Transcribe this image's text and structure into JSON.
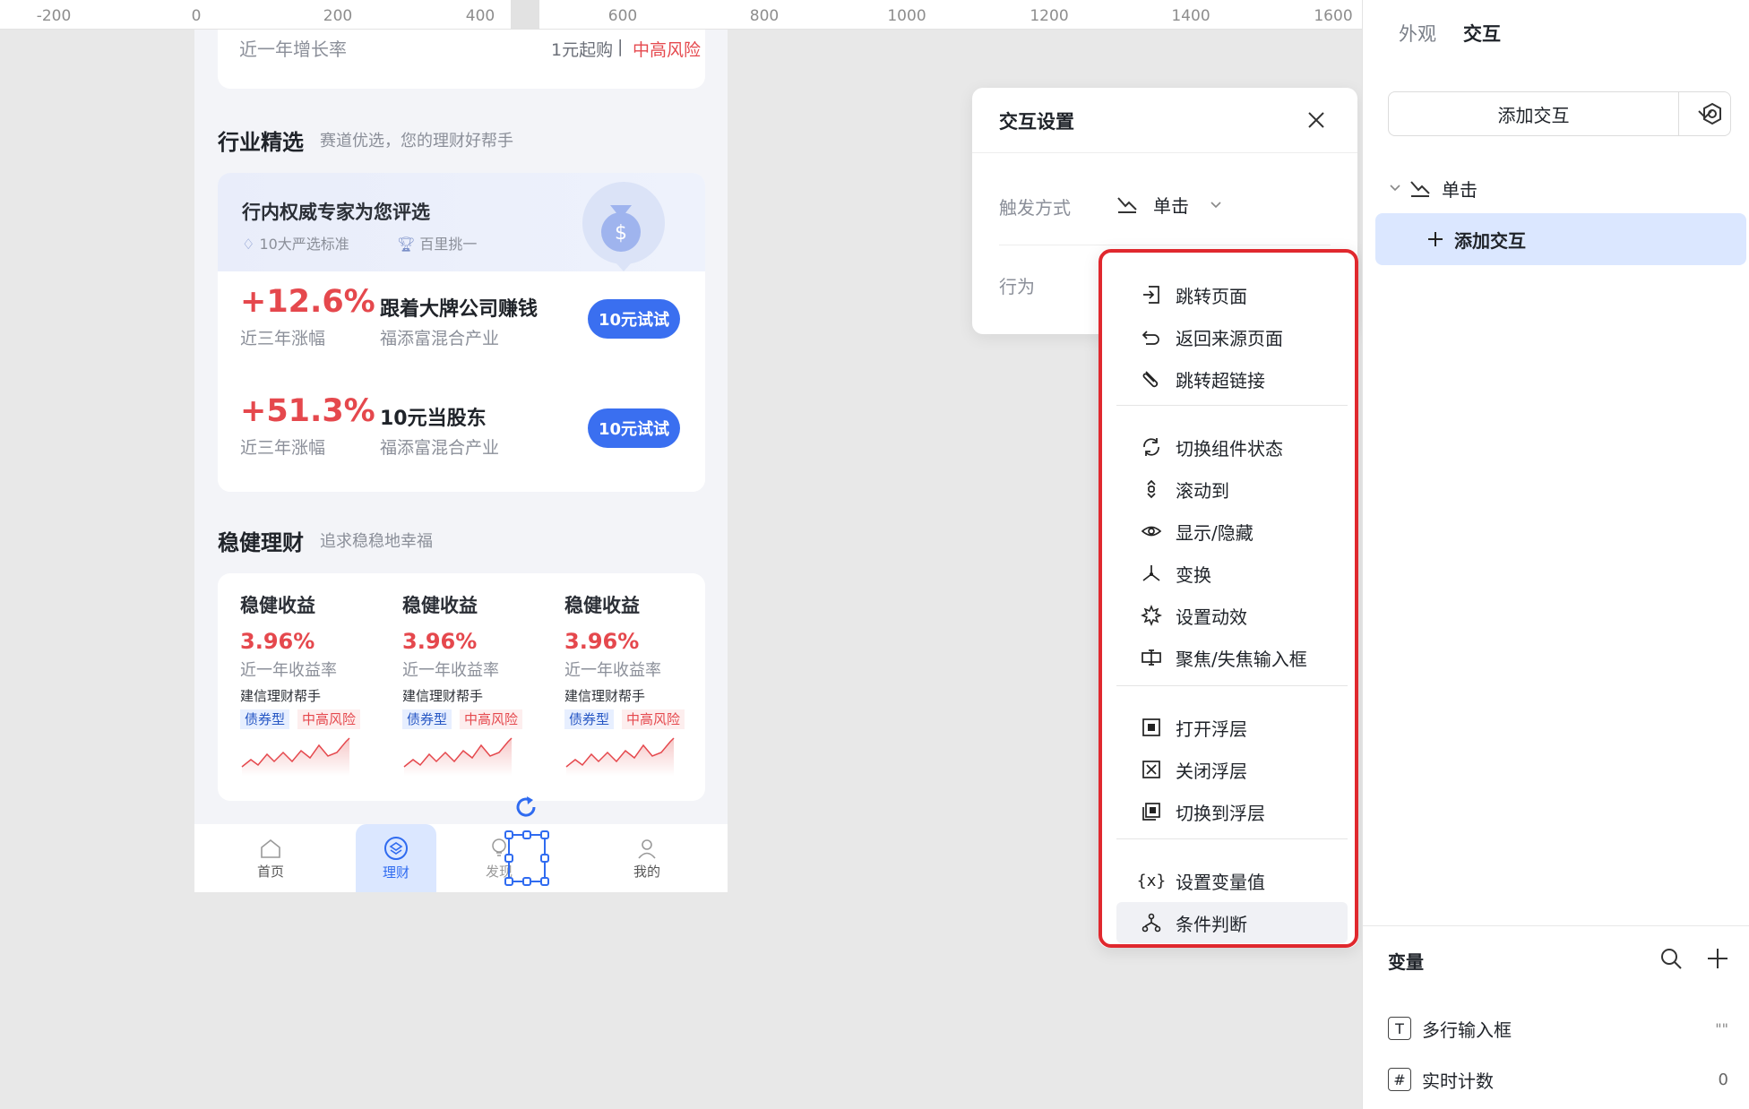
{
  "ruler": {
    "ticks": [
      "-200",
      "0",
      "200",
      "400",
      "600",
      "800",
      "1000",
      "1200",
      "1400",
      "1600"
    ]
  },
  "phone": {
    "top_card": {
      "label": "近一年增长率",
      "start": "1元起购",
      "divider": "|",
      "risk": "中高风险"
    },
    "industry": {
      "title": "行业精选",
      "subtitle": "赛道优选，您的理财好帮手",
      "banner_title": "行内权威专家为您评选",
      "badge1": "10大严选标准",
      "badge2": "百里挑一",
      "funds": [
        {
          "rate": "+12.6%",
          "rate_label": "近三年涨幅",
          "name": "跟着大牌公司赚钱",
          "sub": "福添富混合产业",
          "btn": "10元试试"
        },
        {
          "rate": "+51.3%",
          "rate_label": "近三年涨幅",
          "name": "10元当股东",
          "sub": "福添富混合产业",
          "btn": "10元试试"
        }
      ]
    },
    "stable": {
      "title": "稳健理财",
      "subtitle": "追求稳稳地幸福",
      "items": [
        {
          "name": "稳健收益",
          "rate": "3.96%",
          "rate_label": "近一年收益率",
          "manager": "建信理财帮手",
          "tag1": "债券型",
          "tag2": "中高风险"
        },
        {
          "name": "稳健收益",
          "rate": "3.96%",
          "rate_label": "近一年收益率",
          "manager": "建信理财帮手",
          "tag1": "债券型",
          "tag2": "中高风险"
        },
        {
          "name": "稳健收益",
          "rate": "3.96%",
          "rate_label": "近一年收益率",
          "manager": "建信理财帮手",
          "tag1": "债券型",
          "tag2": "中高风险"
        }
      ]
    },
    "tabbar": {
      "home": "首页",
      "finance": "理财",
      "discover": "发现",
      "mine": "我的"
    }
  },
  "popup": {
    "title": "交互设置",
    "trigger_label": "触发方式",
    "trigger_value": "单击",
    "action_label": "行为"
  },
  "dropdown": {
    "groups": [
      [
        {
          "label": "跳转页面",
          "icon": "page-jump-icon"
        },
        {
          "label": "返回来源页面",
          "icon": "back-arrow-icon"
        },
        {
          "label": "跳转超链接",
          "icon": "link-icon"
        }
      ],
      [
        {
          "label": "切换组件状态",
          "icon": "cycle-icon"
        },
        {
          "label": "滚动到",
          "icon": "scroll-icon"
        },
        {
          "label": "显示/隐藏",
          "icon": "eye-icon"
        },
        {
          "label": "变换",
          "icon": "transform-icon"
        },
        {
          "label": "设置动效",
          "icon": "effect-icon"
        },
        {
          "label": "聚焦/失焦输入框",
          "icon": "focus-input-icon"
        }
      ],
      [
        {
          "label": "打开浮层",
          "icon": "open-layer-icon"
        },
        {
          "label": "关闭浮层",
          "icon": "close-layer-icon"
        },
        {
          "label": "切换到浮层",
          "icon": "switch-layer-icon"
        }
      ],
      [
        {
          "label": "设置变量值",
          "icon": "variable-icon"
        },
        {
          "label": "条件判断",
          "icon": "condition-icon"
        }
      ]
    ]
  },
  "right_panel": {
    "tab_appearance": "外观",
    "tab_interaction": "交互",
    "add_button": "添加交互",
    "tree_trigger": "单击",
    "tree_add": "添加交互",
    "variables_title": "变量",
    "variables": [
      {
        "icon": "T",
        "name": "多行输入框",
        "value": "\"\""
      },
      {
        "icon": "#",
        "name": "实时计数",
        "value": "0"
      }
    ]
  },
  "colors": {
    "accent": "#3a6ff0",
    "red": "#e5484d",
    "highlight": "#e0282e",
    "selected_bg": "#dbe7ff"
  }
}
